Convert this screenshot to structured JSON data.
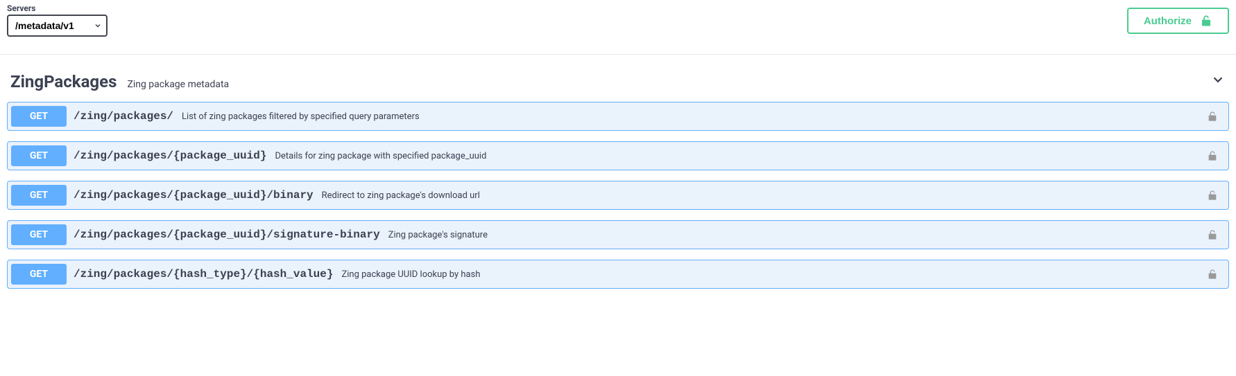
{
  "servers": {
    "label": "Servers",
    "selected": "/metadata/v1"
  },
  "authorize": {
    "label": "Authorize"
  },
  "tag": {
    "name": "ZingPackages",
    "description": "Zing package metadata"
  },
  "operations": [
    {
      "method": "GET",
      "path": "/zing/packages/",
      "summary": "List of zing packages filtered by specified query parameters"
    },
    {
      "method": "GET",
      "path": "/zing/packages/{package_uuid}",
      "summary": "Details for zing package with specified package_uuid"
    },
    {
      "method": "GET",
      "path": "/zing/packages/{package_uuid}/binary",
      "summary": "Redirect to zing package's download url"
    },
    {
      "method": "GET",
      "path": "/zing/packages/{package_uuid}/signature-binary",
      "summary": "Zing package's signature"
    },
    {
      "method": "GET",
      "path": "/zing/packages/{hash_type}/{hash_value}",
      "summary": "Zing package UUID lookup by hash"
    }
  ]
}
